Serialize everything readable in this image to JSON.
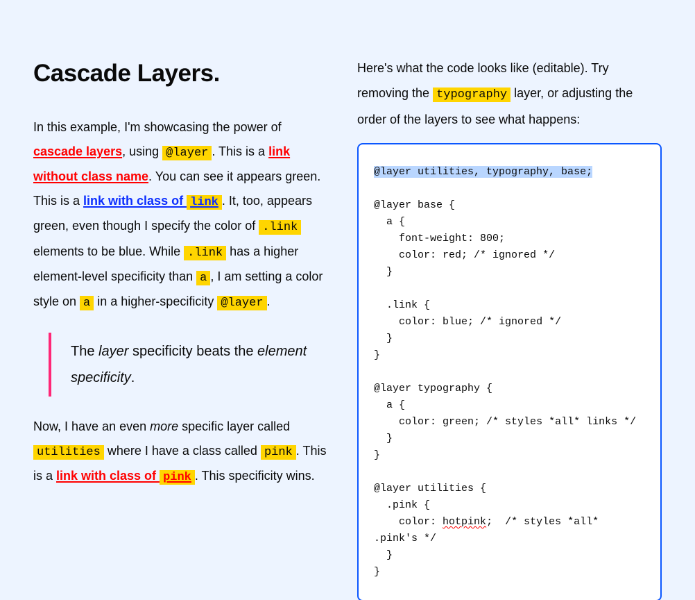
{
  "heading": "Cascade Layers.",
  "p1": {
    "t0": "In this example, I'm showcasing the power of ",
    "link1": "cascade layers",
    "t1": ", using ",
    "code1": "@layer",
    "t2": ". This is a ",
    "link2": "link without class name",
    "t3": ". You can see it appears green. This is a ",
    "link3_pre": "link with class of ",
    "link3_code": "link",
    "t4": ". It, too, appears green, even though I specify the color of ",
    "code2": ".link",
    "t5": " elements to be blue. While ",
    "code3": ".link",
    "t6": " has a higher element-level specificity than ",
    "code4": "a",
    "t7": ", I am setting a color style on ",
    "code5": "a",
    "t8": " in a higher-specificity ",
    "code6": "@layer",
    "t9": "."
  },
  "quote": {
    "t0": "The ",
    "em1": "layer",
    "t1": " specificity beats the ",
    "em2": "element specificity",
    "t2": "."
  },
  "p2": {
    "t0": "Now, I have an even ",
    "em1": "more",
    "t1": " specific layer called ",
    "code1": "utilities",
    "t2": " where I have a class called ",
    "code2": "pink",
    "t3": ". This is a ",
    "link1_pre": "link with class of ",
    "link1_code": "pink",
    "t4": ". This specificity wins."
  },
  "right_intro": {
    "t0": "Here's what the code looks like (editable). Try removing the ",
    "code1": "typography",
    "t1": " layer, or adjusting the order of the layers to see what happens:"
  },
  "code": {
    "line_sel": "@layer utilities, typography, base;",
    "block": "\n\n@layer base {\n  a {\n    font-weight: 800;\n    color: red; /* ignored */\n  }\n\n  .link {\n    color: blue; /* ignored */\n  }\n}\n\n@layer typography {\n  a {\n    color: green; /* styles *all* links */\n  }\n}\n\n@layer utilities {\n  .pink {\n    color: ",
    "spell": "hotpink",
    "block2": ";  /* styles *all* .pink's */\n  }\n}"
  }
}
